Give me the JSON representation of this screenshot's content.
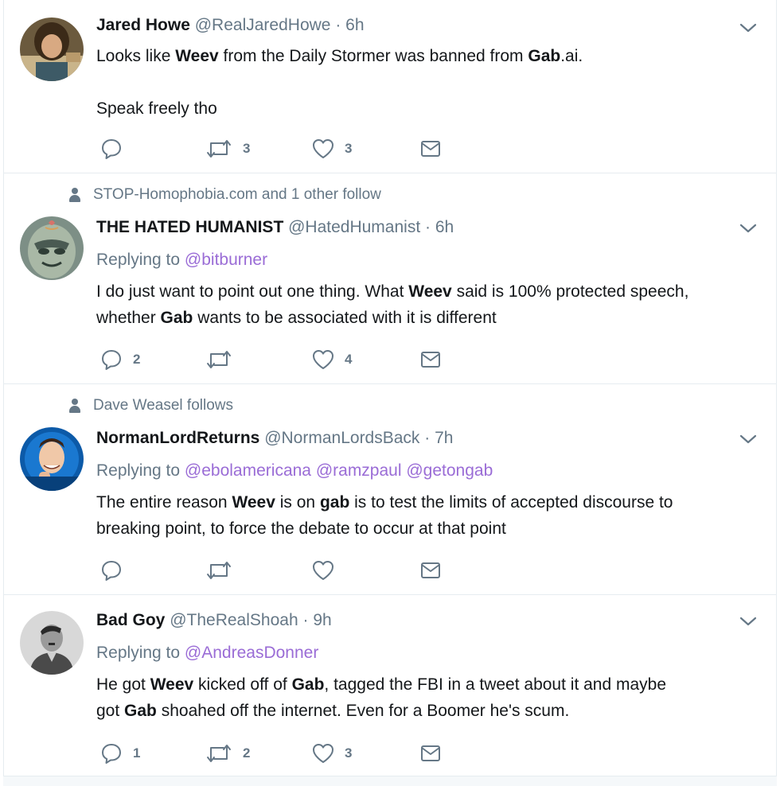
{
  "tweets": [
    {
      "social_context": "",
      "name": "Jared Howe",
      "handle": "@RealJaredHowe",
      "time": "6h",
      "replying_label": "",
      "mentions": [],
      "text_segments": [
        {
          "t": "Looks like ",
          "b": false
        },
        {
          "t": "Weev",
          "b": true
        },
        {
          "t": " from the Daily Stormer was banned from ",
          "b": false
        },
        {
          "t": "Gab",
          "b": true
        },
        {
          "t": ".ai.",
          "b": false
        },
        {
          "br": 2
        },
        {
          "t": "Speak freely tho",
          "b": false
        }
      ],
      "replies": "",
      "retweets": "3",
      "likes": "3"
    },
    {
      "social_context": "STOP-Homophobia.com and 1 other follow",
      "name": "THE HATED HUMANIST",
      "handle": "@HatedHumanist",
      "time": "6h",
      "replying_label": "Replying to",
      "mentions": [
        "@bitburner"
      ],
      "text_segments": [
        {
          "t": "I do just want to point out one thing. What ",
          "b": false
        },
        {
          "t": "Weev",
          "b": true
        },
        {
          "t": " said is 100% protected speech,",
          "b": false
        },
        {
          "br": 1
        },
        {
          "t": "whether ",
          "b": false
        },
        {
          "t": "Gab",
          "b": true
        },
        {
          "t": " wants to be associated with it is different",
          "b": false
        }
      ],
      "replies": "2",
      "retweets": "",
      "likes": "4"
    },
    {
      "social_context": "Dave Weasel follows",
      "name": "NormanLordReturns",
      "handle": "@NormanLordsBack",
      "time": "7h",
      "replying_label": "Replying to",
      "mentions": [
        "@ebolamericana",
        "@ramzpaul",
        "@getongab"
      ],
      "text_segments": [
        {
          "t": "The entire reason ",
          "b": false
        },
        {
          "t": "Weev",
          "b": true
        },
        {
          "t": " is on ",
          "b": false
        },
        {
          "t": "gab",
          "b": true
        },
        {
          "t": " is to test the limits of accepted discourse to",
          "b": false
        },
        {
          "br": 1
        },
        {
          "t": "breaking point, to force the debate to occur at that point",
          "b": false
        }
      ],
      "replies": "",
      "retweets": "",
      "likes": ""
    },
    {
      "social_context": "",
      "name": "Bad Goy",
      "handle": "@TheRealShoah",
      "time": "9h",
      "replying_label": "Replying to",
      "mentions": [
        "@AndreasDonner"
      ],
      "text_segments": [
        {
          "t": "He got ",
          "b": false
        },
        {
          "t": "Weev",
          "b": true
        },
        {
          "t": " kicked off of ",
          "b": false
        },
        {
          "t": "Gab",
          "b": true
        },
        {
          "t": ", tagged the FBI in a tweet about it and maybe",
          "b": false
        },
        {
          "br": 1
        },
        {
          "t": "got ",
          "b": false
        },
        {
          "t": "Gab",
          "b": true
        },
        {
          "t": " shoahed off the internet. Even for a Boomer he's scum.",
          "b": false
        }
      ],
      "replies": "1",
      "retweets": "2",
      "likes": "3"
    }
  ],
  "separator_dot": "·",
  "icons": {
    "reply": "reply-icon",
    "retweet": "retweet-icon",
    "like": "heart-icon",
    "dm": "envelope-icon",
    "menu": "chevron-down-icon",
    "social": "person-icon"
  },
  "colors": {
    "text": "#14171a",
    "secondary": "#657786",
    "mention": "#9a6cd6",
    "border": "#e6ecf0"
  }
}
